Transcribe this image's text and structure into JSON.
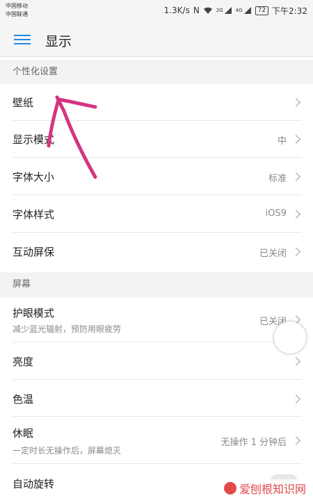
{
  "status_bar": {
    "carrier_1": "中国移动",
    "carrier_2": "中国联通",
    "speed": "1.3K/s",
    "nfc": "N",
    "net_1": "2G",
    "net_2": "4G",
    "battery": "72",
    "time": "下午2:32"
  },
  "app_bar": {
    "title": "显示"
  },
  "sections": {
    "personalize": "个性化设置",
    "screen": "屏幕"
  },
  "rows": {
    "wallpaper": {
      "title": "壁纸",
      "value": ""
    },
    "display_mode": {
      "title": "显示模式",
      "value": "中"
    },
    "font_size": {
      "title": "字体大小",
      "value": "标准"
    },
    "font_style": {
      "title": "字体样式",
      "value": "iOS9"
    },
    "screensaver": {
      "title": "互动屏保",
      "value": "已关闭"
    },
    "eye_comfort": {
      "title": "护眼模式",
      "subtitle": "减少蓝光辐射，预防用眼疲劳",
      "value": "已关闭"
    },
    "brightness": {
      "title": "亮度",
      "value": ""
    },
    "color_temp": {
      "title": "色温",
      "value": ""
    },
    "sleep": {
      "title": "休眠",
      "subtitle": "一定时长无操作后，屏幕熄灭",
      "value": "无操作 1 分钟后"
    },
    "auto_rotate": {
      "title": "自动旋转"
    }
  },
  "watermark": {
    "text": "爱刨根知识网"
  },
  "colors": {
    "accent": "#1e88e5",
    "annotation": "#d63384"
  }
}
